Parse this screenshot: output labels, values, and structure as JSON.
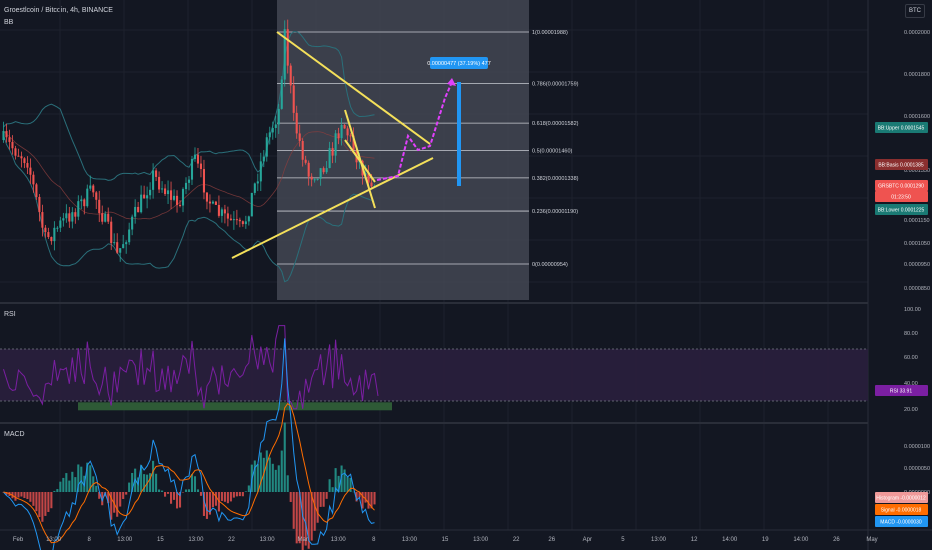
{
  "header": {
    "symbol_title": "Groestlcoin / Bitcoin, 4h, BINANCE",
    "indicator_bb": "BB",
    "currency": "BTC"
  },
  "panes": {
    "rsi_title": "RSI",
    "macd_title": "MACD"
  },
  "measure_label": "0.00000477 (37.19%) 477",
  "price_axis_ticks": [
    "0.0002000",
    "0.0001800",
    "0.0001600",
    "0.0001350",
    "0.0001150",
    "0.0001050",
    "0.0000950",
    "0.0000850"
  ],
  "rsi_axis_ticks": [
    "100.00",
    "80.00",
    "60.00",
    "40.00",
    "20.00"
  ],
  "macd_axis_ticks": [
    "0.0000100",
    "0.0000050",
    "0.0000000"
  ],
  "badges": {
    "bb_upper": "BB:Upper  0.0001545",
    "bb_basis": "BB:Basis  0.0001385",
    "grs_price": "GRSBTC  0.0001290",
    "countdown": "01:23:50",
    "bb_lower": "BB:Lower  0.0001225",
    "rsi": "RSI  33.91",
    "histogram": "Histogram  -0.0000012",
    "signal": "Signal  -0.0000018",
    "macd": "MACD  -0.0000030"
  },
  "colors": {
    "background": "#131722",
    "grid": "#1e222d",
    "candle_up": "#26a69a",
    "candle_down": "#ef5350",
    "fib_zone": "#4a4e59",
    "trendline": "#f4e05a",
    "projection": "#e040fb",
    "measure": "#2196f3",
    "rsi_line": "#7b1fa2",
    "rsi_band": "#2a1f3d",
    "rsi_highlight": "#2e5a36",
    "macd_line": "#2196f3",
    "signal_line": "#ff6d00",
    "bb_line": "#2a6f7a"
  },
  "chart_data": {
    "type": "candlestick",
    "title": "Groestlcoin / Bitcoin, 4h, BINANCE",
    "x_ticks": [
      "Feb",
      "13:00",
      "8",
      "13:00",
      "15",
      "13:00",
      "22",
      "13:00",
      "Mar",
      "13:00",
      "8",
      "13:00",
      "15",
      "13:00",
      "22",
      "26",
      "Apr",
      "5",
      "13:00",
      "12",
      "14:00",
      "19",
      "14:00",
      "26",
      "May"
    ],
    "fibonacci_levels": [
      {
        "label": "1(0.00001988)",
        "ratio": 1,
        "price": 1.988e-05
      },
      {
        "label": "0.786(0.00001759)",
        "ratio": 0.786,
        "price": 1.759e-05
      },
      {
        "label": "0.618(0.00001582)",
        "ratio": 0.618,
        "price": 1.582e-05
      },
      {
        "label": "0.5(0.00001460)",
        "ratio": 0.5,
        "price": 1.46e-05
      },
      {
        "label": "0.382(0.00001338)",
        "ratio": 0.382,
        "price": 1.338e-05
      },
      {
        "label": "0.236(0.00001190)",
        "ratio": 0.236,
        "price": 1.19e-05
      },
      {
        "label": "0(0.00000954)",
        "ratio": 0,
        "price": 9.54e-06
      }
    ],
    "last_values": {
      "price": 0.000129,
      "bb_upper": 0.0001545,
      "bb_basis": 0.0001385,
      "bb_lower": 0.0001225,
      "rsi": 33.91,
      "histogram": -1.2e-06,
      "signal": -1.8e-06,
      "macd": -3e-06
    },
    "rsi_bands": [
      30,
      70
    ],
    "price_range_shown": [
      8e-05,
      0.0002
    ],
    "rsi_range": [
      20,
      100
    ],
    "grid": true
  }
}
